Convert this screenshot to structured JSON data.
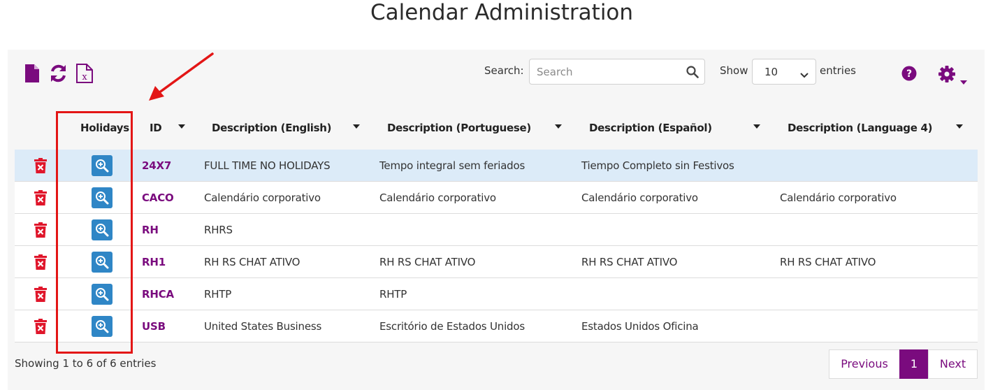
{
  "page": {
    "title": "Calendar Administration"
  },
  "toolbar": {
    "icons": [
      "new-file-icon",
      "refresh-icon",
      "excel-export-icon"
    ],
    "search_label": "Search:",
    "search_placeholder": "Search",
    "show_label": "Show",
    "page_length": "10",
    "entries_label": "entries",
    "accent_color": "#7a0b7e"
  },
  "table": {
    "columns": [
      "Holidays",
      "ID",
      "Description (English)",
      "Description (Portuguese)",
      "Description (Español)",
      "Description (Language 4)"
    ],
    "rows": [
      {
        "id": "24X7",
        "en": "FULL TIME NO HOLIDAYS",
        "pt": "Tempo integral sem feriados",
        "es": "Tiempo Completo sin Festivos",
        "l4": ""
      },
      {
        "id": "CACO",
        "en": "Calendário corporativo",
        "pt": "Calendário corporativo",
        "es": "Calendário corporativo",
        "l4": "Calendário corporativo"
      },
      {
        "id": "RH",
        "en": "RHRS",
        "pt": "",
        "es": "",
        "l4": ""
      },
      {
        "id": "RH1",
        "en": "RH RS CHAT ATIVO",
        "pt": "RH RS CHAT ATIVO",
        "es": "RH RS CHAT ATIVO",
        "l4": "RH RS CHAT ATIVO"
      },
      {
        "id": "RHCA",
        "en": "RHTP",
        "pt": "RHTP",
        "es": "",
        "l4": ""
      },
      {
        "id": "USB",
        "en": "United States Business",
        "pt": "Escritório de Estados Unidos",
        "es": "Estados Unidos Oficina",
        "l4": ""
      }
    ],
    "selected_row": 0
  },
  "footer": {
    "info": "Showing 1 to 6 of 6 entries",
    "previous": "Previous",
    "current_page": "1",
    "next": "Next"
  },
  "annotation": {
    "color": "#e31616"
  }
}
